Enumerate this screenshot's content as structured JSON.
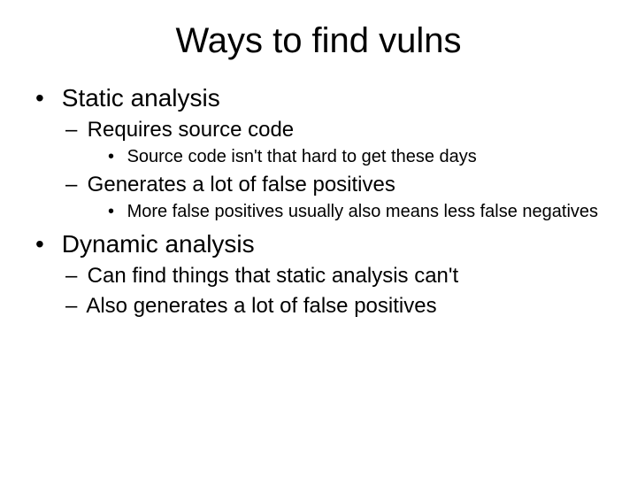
{
  "title": "Ways to find vulns",
  "bullets": {
    "static": {
      "label": "Static analysis",
      "req": {
        "label": "Requires source code",
        "sub": "Source code isn't that hard to get these days"
      },
      "fp": {
        "label": "Generates a lot of false positives",
        "sub": "More false positives usually also means less false negatives"
      }
    },
    "dynamic": {
      "label": "Dynamic analysis",
      "find": "Can find things that static analysis can't",
      "fp": "Also generates a lot of false positives"
    }
  }
}
